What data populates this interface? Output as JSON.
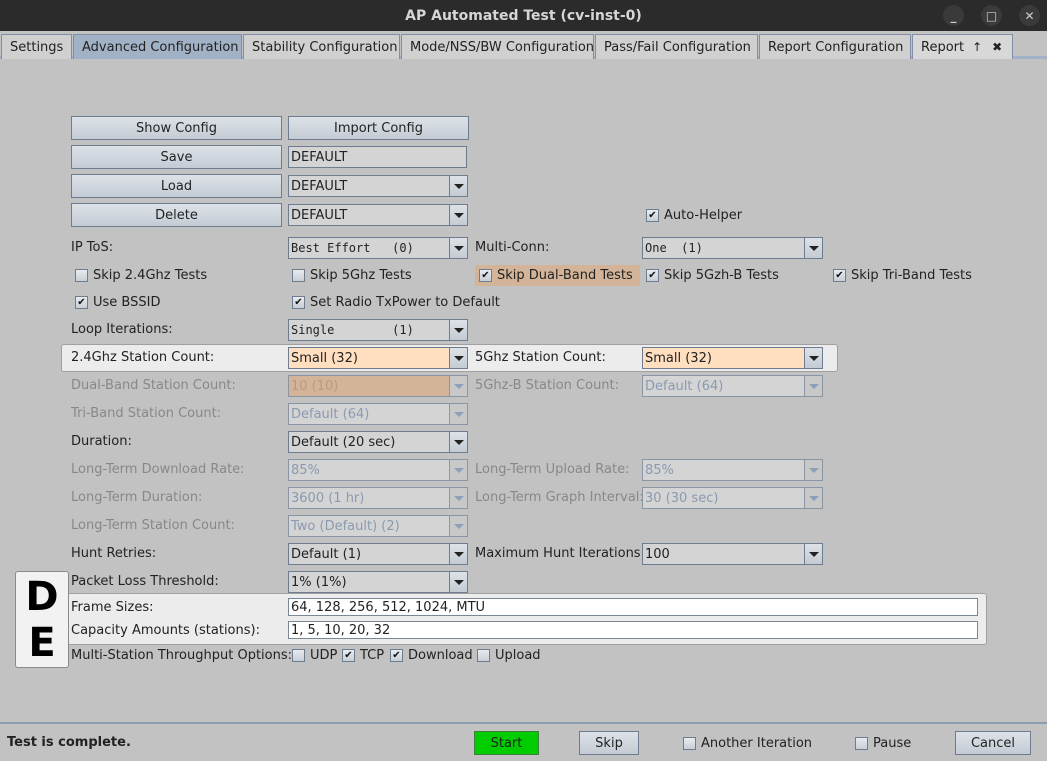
{
  "window": {
    "title": "AP Automated Test  (cv-inst-0)",
    "controls": {
      "minimize": "_",
      "maximize": "□",
      "close": "✕"
    }
  },
  "tabs": [
    {
      "label": "Settings",
      "active": false
    },
    {
      "label": "Advanced Configuration",
      "active": true
    },
    {
      "label": "Stability Configuration",
      "active": false
    },
    {
      "label": "Mode/NSS/BW Configuration",
      "active": false
    },
    {
      "label": "Pass/Fail Configuration",
      "active": false
    },
    {
      "label": "Report Configuration",
      "active": false
    },
    {
      "label": "Report",
      "active": false,
      "icons": [
        "↑",
        "✖"
      ]
    }
  ],
  "config": {
    "show_config": "Show Config",
    "import_config": "Import Config",
    "save": "Save",
    "save_name": "DEFAULT",
    "load": "Load",
    "load_value": "DEFAULT",
    "delete": "Delete",
    "delete_value": "DEFAULT",
    "auto_helper": {
      "label": "Auto-Helper",
      "checked": true
    }
  },
  "fields": {
    "ip_tos": {
      "label": "IP ToS:",
      "value": "Best Effort   (0)"
    },
    "multi_conn": {
      "label": "Multi-Conn:",
      "value": "One  (1)"
    },
    "skip_24": {
      "label": "Skip 2.4Ghz Tests",
      "checked": false
    },
    "skip_5": {
      "label": "Skip 5Ghz Tests",
      "checked": false
    },
    "skip_dual": {
      "label": "Skip Dual-Band Tests",
      "checked": true
    },
    "skip_5b": {
      "label": "Skip 5Gzh-B Tests",
      "checked": true
    },
    "skip_tri": {
      "label": "Skip Tri-Band Tests",
      "checked": true
    },
    "use_bssid": {
      "label": "Use BSSID",
      "checked": true
    },
    "set_txpower": {
      "label": "Set Radio TxPower to Default",
      "checked": true
    },
    "loop_iterations": {
      "label": "Loop Iterations:",
      "value": "Single        (1)"
    },
    "station_24": {
      "label": "2.4Ghz Station Count:",
      "value": "Small (32)"
    },
    "station_5": {
      "label": "5Ghz Station Count:",
      "value": "Small (32)"
    },
    "station_dual": {
      "label": "Dual-Band Station Count:",
      "value": "10 (10)"
    },
    "station_5b": {
      "label": "5Ghz-B Station Count:",
      "value": "Default (64)"
    },
    "station_tri": {
      "label": "Tri-Band Station Count:",
      "value": "Default (64)"
    },
    "duration": {
      "label": "Duration:",
      "value": "Default (20 sec)"
    },
    "lt_download": {
      "label": "Long-Term Download Rate:",
      "value": "85%"
    },
    "lt_upload": {
      "label": "Long-Term Upload Rate:",
      "value": "85%"
    },
    "lt_duration": {
      "label": "Long-Term Duration:",
      "value": "3600 (1 hr)"
    },
    "lt_graph": {
      "label": "Long-Term Graph Interval:",
      "value": "30 (30 sec)"
    },
    "lt_station": {
      "label": "Long-Term Station Count:",
      "value": "Two (Default) (2)"
    },
    "hunt_retries": {
      "label": "Hunt Retries:",
      "value": "Default (1)"
    },
    "max_hunt": {
      "label": "Maximum Hunt Iterations:",
      "value": "100"
    },
    "packet_loss": {
      "label": "Packet Loss Threshold:",
      "value": "1% (1%)"
    },
    "frame_sizes": {
      "label": "Frame Sizes:",
      "value": "64, 128, 256, 512, 1024, MTU"
    },
    "capacity": {
      "label": "Capacity Amounts (stations):",
      "value": "1, 5, 10, 20, 32"
    },
    "multi_station": {
      "label": "Multi-Station Throughput Options:",
      "udp": {
        "label": "UDP",
        "checked": false
      },
      "tcp": {
        "label": "TCP",
        "checked": true
      },
      "download": {
        "label": "Download",
        "checked": true
      },
      "upload": {
        "label": "Upload",
        "checked": false
      }
    }
  },
  "annotation": {
    "line1": "D",
    "line2": "E"
  },
  "footer": {
    "status": "Test is complete.",
    "start": "Start",
    "skip": "Skip",
    "another_iteration": {
      "label": "Another Iteration",
      "checked": false
    },
    "pause": {
      "label": "Pause",
      "checked": false
    },
    "cancel": "Cancel"
  },
  "glyphs": {
    "check": "✔"
  }
}
